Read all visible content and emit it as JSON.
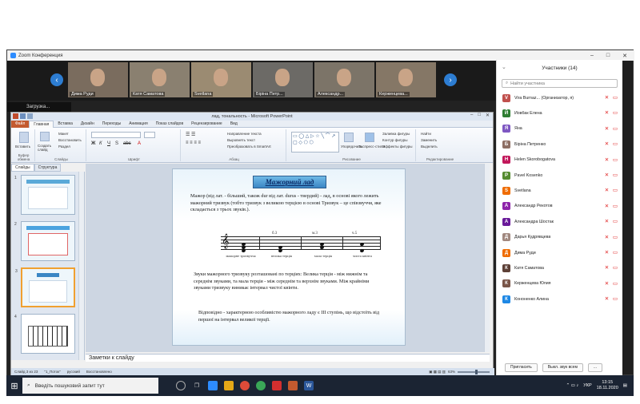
{
  "zoom": {
    "window_title": "Zoom Конференция",
    "share_tab_label": "Загрузка...",
    "video_names": [
      "Дима Руди",
      "Катя Саматова",
      "Svetlana",
      "Біріна Петр...",
      "Александр...",
      "Керженцева..."
    ]
  },
  "ppt": {
    "title": "лад, тональность - Microsoft PowerPoint",
    "file_tab": "Файл",
    "tabs": [
      "Главная",
      "Вставка",
      "Дизайн",
      "Переходы",
      "Анимация",
      "Показ слайдов",
      "Рецензирование",
      "Вид"
    ],
    "ribbon": {
      "paste": "Вставить",
      "create_slide": "Создать слайд",
      "layout": "Макет",
      "restore": "Восстановить",
      "section": "Раздел",
      "groups": [
        "Буфер обмена",
        "Слайды",
        "Шрифт",
        "Абзац",
        "Рисование",
        "Редактирование"
      ],
      "text_dir": "Направление текста",
      "align_text": "Выровнять текст",
      "convert_smartart": "Преобразовать в SmartArt",
      "arrange": "Упорядочить",
      "quick_styles": "Экспресс-стили",
      "shape_fill": "Заливка фигуры",
      "shape_outline": "Контур фигуры",
      "shape_effects": "Эффекты фигуры",
      "find": "Найти",
      "replace": "Заменить",
      "select": "Выделить"
    },
    "panel_tabs": [
      "Слайды",
      "Структура"
    ],
    "notes_placeholder": "Заметки к слайду",
    "status": {
      "slide": "Слайд 3 из 23",
      "theme": "\"1_Поток\"",
      "lang": "русский",
      "mode": "Восстановлено",
      "zoom": "63%"
    }
  },
  "slide": {
    "heading": "Мажорний лад",
    "para1": "Мажор (від лат. - більший, також dur від лат. durus - твердий) - лад, в основі якого лежить мажорний тризвук (тобто тризвук з великою терцією в основі Тризвук – це співзвуччя, яке складається з трьох звуків.).",
    "intervals_top": [
      "б.3",
      "м.3",
      "ч.5"
    ],
    "labels": [
      "мажорне тризвуччя",
      "велика терція",
      "мала терція",
      "чиста квінта"
    ],
    "para2": "Звуки мажорного тризвуку розташовані по терціях: Велика терція - між нижнім та середнім звуками, та мала терція - між середнім та верхнім звуками. Між крайніми звуками тризвуку виникає інтервал чистої квінти.",
    "para3": "Відповідно - характерною особливістю мажорного ладу є III ступінь, що відстоїть від першої на інтервал великої терції."
  },
  "participants": {
    "title": "Участники (14)",
    "search_placeholder": "Найти участника",
    "list": [
      {
        "initial": "V",
        "name": "Vira Burnaz... (Организатор, я)",
        "color": "#c0504d"
      },
      {
        "initial": "Й",
        "name": "Йовбак Елена",
        "color": "#2e7d32"
      },
      {
        "initial": "Я",
        "name": "Яна",
        "color": "#7e57c2"
      },
      {
        "initial": "Б",
        "name": "Біріна Петренко",
        "color": "#8d6e63"
      },
      {
        "initial": "H",
        "name": "Helen Skorobogatova",
        "color": "#c2185b"
      },
      {
        "initial": "P",
        "name": "Pavel Kosenko",
        "color": "#558b2f"
      },
      {
        "initial": "S",
        "name": "Svetlana",
        "color": "#ef6c00"
      },
      {
        "initial": "A",
        "name": "Александр Рекотов",
        "color": "#8e24aa"
      },
      {
        "initial": "A",
        "name": "Александра Шостак",
        "color": "#6a1b9a"
      },
      {
        "initial": "Д",
        "name": "Дарья Кудрявцева",
        "color": "#a1887f"
      },
      {
        "initial": "Д",
        "name": "Дима Руди",
        "color": "#ef6c00"
      },
      {
        "initial": "К",
        "name": "Катя Саматова",
        "color": "#5d4037"
      },
      {
        "initial": "К",
        "name": "Керженцева Юлия",
        "color": "#795548"
      },
      {
        "initial": "К",
        "name": "Кононенко Алина",
        "color": "#1e88e5"
      }
    ],
    "invite": "Пригласить",
    "mute_all": "Выкл. звук всем",
    "more": "..."
  },
  "taskbar": {
    "search_placeholder": "Введіть пошуковий запит тут",
    "lang": "УКР",
    "time": "13:15",
    "date": "18.11.2020"
  }
}
